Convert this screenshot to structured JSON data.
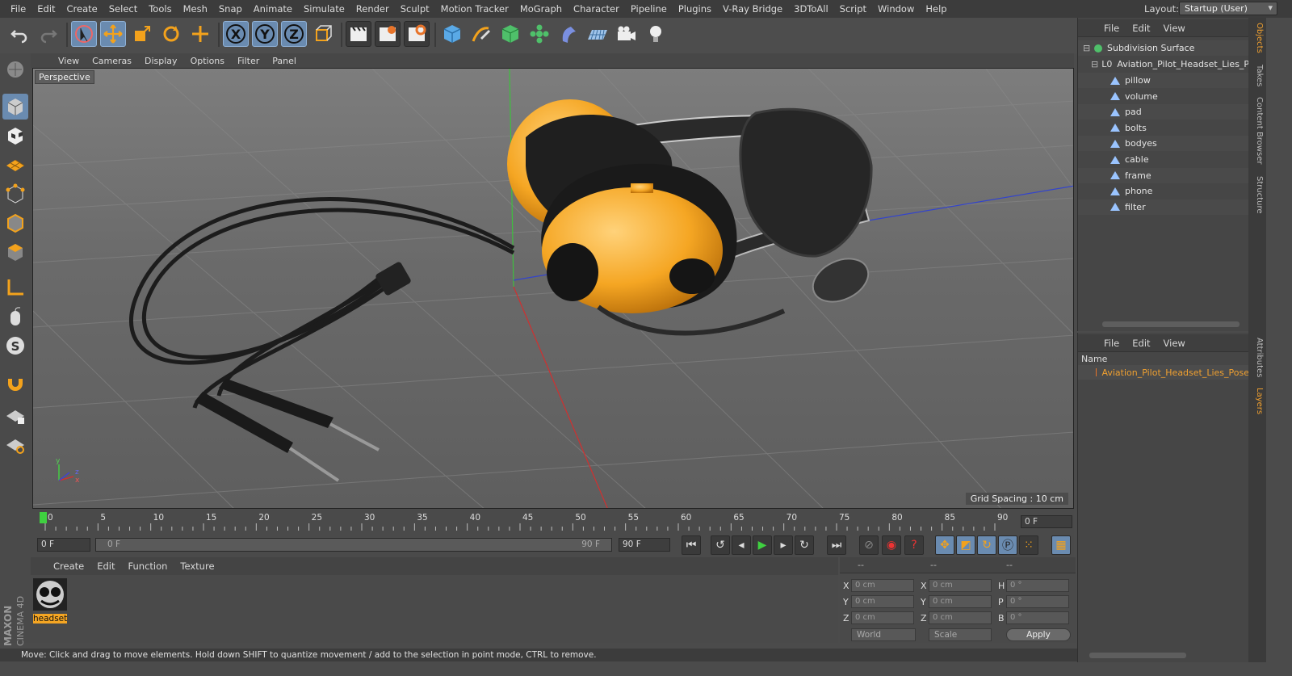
{
  "menubar": {
    "items": [
      "File",
      "Edit",
      "Create",
      "Select",
      "Tools",
      "Mesh",
      "Snap",
      "Animate",
      "Simulate",
      "Render",
      "Sculpt",
      "Motion Tracker",
      "MoGraph",
      "Character",
      "Pipeline",
      "Plugins",
      "V-Ray Bridge",
      "3DToAll",
      "Script",
      "Window",
      "Help"
    ],
    "layout_label": "Layout:",
    "layout_value": "Startup (User)"
  },
  "viewport": {
    "menu": [
      "View",
      "Cameras",
      "Display",
      "Options",
      "Filter",
      "Panel"
    ],
    "label": "Perspective",
    "grid_spacing": "Grid Spacing : 10 cm",
    "axis_x": "x",
    "axis_y": "y",
    "axis_z": "z"
  },
  "timeline": {
    "ticks": [
      "0",
      "5",
      "10",
      "15",
      "20",
      "25",
      "30",
      "35",
      "40",
      "45",
      "50",
      "55",
      "60",
      "65",
      "70",
      "75",
      "80",
      "85",
      "90"
    ],
    "current_frame": "0 F",
    "start_field": "0 F",
    "range_start": "0 F",
    "range_end": "90 F",
    "end_field": "90 F"
  },
  "materials": {
    "menu": [
      "Create",
      "Edit",
      "Function",
      "Texture"
    ],
    "items": [
      {
        "name": "headset"
      }
    ]
  },
  "coords": {
    "header": [
      "--",
      "--",
      "--"
    ],
    "rows": [
      {
        "a": "X",
        "av": "0 cm",
        "b": "X",
        "bv": "0 cm",
        "c": "H",
        "cv": "0 °"
      },
      {
        "a": "Y",
        "av": "0 cm",
        "b": "Y",
        "bv": "0 cm",
        "c": "P",
        "cv": "0 °"
      },
      {
        "a": "Z",
        "av": "0 cm",
        "b": "Z",
        "bv": "0 cm",
        "c": "B",
        "cv": "0 °"
      }
    ],
    "world": "World",
    "scale": "Scale",
    "apply": "Apply"
  },
  "status": "Move: Click and drag to move elements. Hold down SHIFT to quantize movement / add to the selection in point mode, CTRL to remove.",
  "objects": {
    "menu": [
      "File",
      "Edit",
      "View"
    ],
    "root": "Subdivision Surface",
    "child": "Aviation_Pilot_Headset_Lies_Pose",
    "items": [
      "pillow",
      "volume",
      "pad",
      "bolts",
      "bodyes",
      "cable",
      "frame",
      "phone",
      "filter"
    ]
  },
  "layers": {
    "menu": [
      "File",
      "Edit",
      "View"
    ],
    "header": "Name",
    "item": "Aviation_Pilot_Headset_Lies_Pose"
  },
  "sidetabs": [
    "Objects",
    "Takes",
    "Content Browser",
    "Structure",
    "Attributes",
    "Layers"
  ],
  "brand": {
    "line1": "MAXON",
    "line2": "CINEMA 4D"
  },
  "colors": {
    "accent": "#6a8bb0",
    "earcup": "#f5a623",
    "highlight": "#f0a030"
  }
}
